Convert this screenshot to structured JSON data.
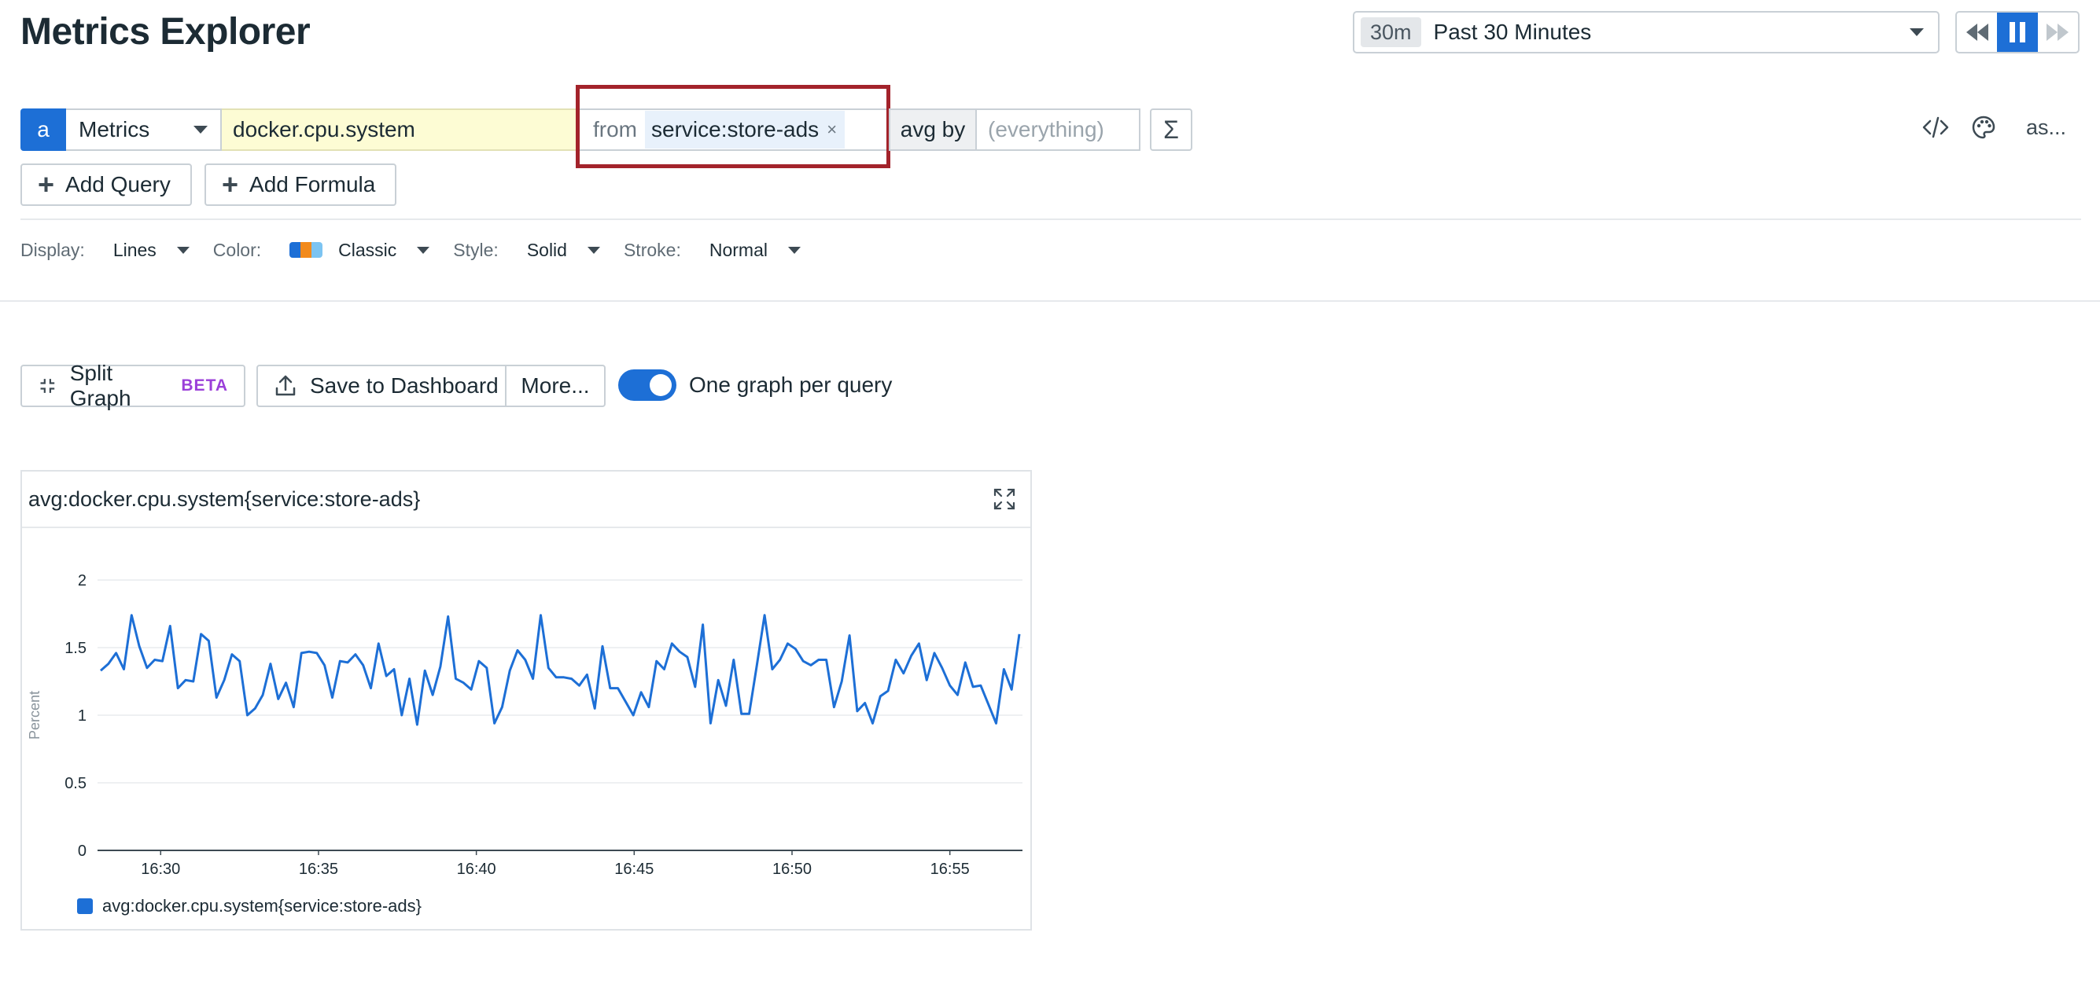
{
  "page": {
    "title": "Metrics Explorer"
  },
  "time": {
    "badge": "30m",
    "label": "Past 30 Minutes"
  },
  "query": {
    "letter": "a",
    "source": "Metrics",
    "metric": "docker.cpu.system",
    "from_label": "from",
    "from_tag": "service:store-ads",
    "tag_remove": "×",
    "avg_by_label": "avg by",
    "group_placeholder": "(everything)",
    "sigma": "Σ",
    "as_label": "as..."
  },
  "actions": {
    "add_query": "Add Query",
    "add_formula": "Add Formula"
  },
  "display": {
    "display_label": "Display:",
    "display_value": "Lines",
    "color_label": "Color:",
    "color_value": "Classic",
    "style_label": "Style:",
    "style_value": "Solid",
    "stroke_label": "Stroke:",
    "stroke_value": "Normal",
    "palette_colors": [
      "#1d6fd6",
      "#f28a1c",
      "#7cc4f2"
    ]
  },
  "graph_actions": {
    "split_graph": "Split Graph",
    "beta": "BETA",
    "save_to_dashboard": "Save to Dashboard",
    "more": "More...",
    "one_graph_per_query": "One graph per query",
    "one_graph_per_query_on": true
  },
  "graph": {
    "title": "avg:docker.cpu.system{service:store-ads}",
    "legend": "avg:docker.cpu.system{service:store-ads}"
  },
  "chart_data": {
    "type": "line",
    "ylabel": "Percent",
    "ylim": [
      0,
      2
    ],
    "yticks": [
      {
        "value": 0,
        "label": "0"
      },
      {
        "value": 0.5,
        "label": "0.5"
      },
      {
        "value": 1,
        "label": "1"
      },
      {
        "value": 1.5,
        "label": "1.5"
      },
      {
        "value": 2,
        "label": "2"
      }
    ],
    "xlim": [
      28,
      57.3
    ],
    "xticks": [
      {
        "value": 30,
        "label": "16:30"
      },
      {
        "value": 35,
        "label": "16:35"
      },
      {
        "value": 40,
        "label": "16:40"
      },
      {
        "value": 45,
        "label": "16:45"
      },
      {
        "value": 50,
        "label": "16:50"
      },
      {
        "value": 55,
        "label": "16:55"
      }
    ],
    "grid": true,
    "series": [
      {
        "name": "avg:docker.cpu.system{service:store-ads}",
        "color": "#1d6fd6",
        "values": [
          1.33,
          1.38,
          1.46,
          1.34,
          1.74,
          1.51,
          1.35,
          1.41,
          1.4,
          1.66,
          1.2,
          1.26,
          1.25,
          1.6,
          1.55,
          1.13,
          1.26,
          1.45,
          1.4,
          1.0,
          1.05,
          1.15,
          1.38,
          1.12,
          1.24,
          1.06,
          1.46,
          1.47,
          1.46,
          1.37,
          1.13,
          1.4,
          1.39,
          1.45,
          1.37,
          1.2,
          1.53,
          1.29,
          1.34,
          1.0,
          1.27,
          0.93,
          1.33,
          1.15,
          1.36,
          1.73,
          1.27,
          1.24,
          1.19,
          1.4,
          1.35,
          0.94,
          1.06,
          1.33,
          1.48,
          1.41,
          1.27,
          1.74,
          1.35,
          1.28,
          1.28,
          1.27,
          1.22,
          1.3,
          1.05,
          1.51,
          1.2,
          1.2,
          1.1,
          1.0,
          1.17,
          1.06,
          1.4,
          1.34,
          1.53,
          1.47,
          1.43,
          1.21,
          1.67,
          0.94,
          1.26,
          1.07,
          1.41,
          1.01,
          1.01,
          1.37,
          1.74,
          1.34,
          1.41,
          1.53,
          1.49,
          1.4,
          1.37,
          1.41,
          1.41,
          1.06,
          1.25,
          1.59,
          1.03,
          1.09,
          0.94,
          1.14,
          1.18,
          1.41,
          1.31,
          1.44,
          1.53,
          1.26,
          1.46,
          1.35,
          1.22,
          1.15,
          1.39,
          1.21,
          1.22,
          1.08,
          0.94,
          1.34,
          1.19,
          1.6
        ]
      }
    ]
  }
}
